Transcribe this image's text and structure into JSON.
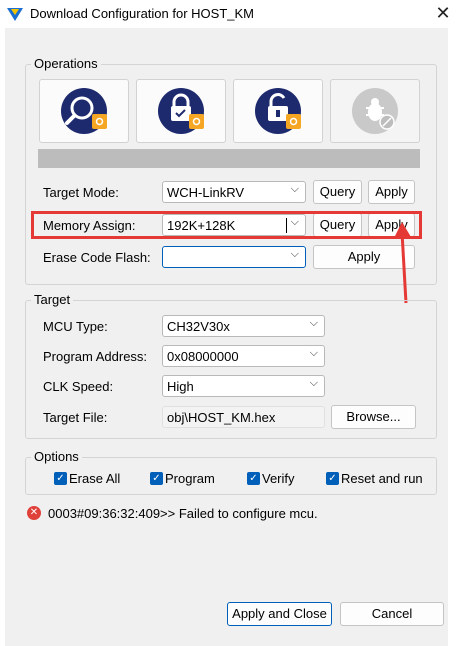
{
  "window": {
    "title": "Download Configuration for HOST_KM",
    "close_label": "✕"
  },
  "operations": {
    "legend": "Operations",
    "target_mode": {
      "label": "Target Mode:",
      "value": "WCH-LinkRV",
      "query_label": "Query",
      "apply_label": "Apply"
    },
    "memory_assign": {
      "label": "Memory Assign:",
      "value": "192K+128K",
      "query_label": "Query",
      "apply_label": "Apply"
    },
    "erase_code_flash": {
      "label": "Erase Code Flash:",
      "value": "",
      "apply_label": "Apply"
    }
  },
  "target": {
    "legend": "Target",
    "mcu_type": {
      "label": "MCU Type:",
      "value": "CH32V30x"
    },
    "program_address": {
      "label": "Program Address:",
      "value": "0x08000000"
    },
    "clk_speed": {
      "label": "CLK Speed:",
      "value": "High"
    },
    "target_file": {
      "label": "Target File:",
      "value": "obj\\HOST_KM.hex",
      "browse_label": "Browse..."
    }
  },
  "options": {
    "legend": "Options",
    "items": [
      {
        "label": "Erase All",
        "checked": true
      },
      {
        "label": "Program",
        "checked": true
      },
      {
        "label": "Verify",
        "checked": true
      },
      {
        "label": "Reset and run",
        "checked": true
      }
    ]
  },
  "log": {
    "message": "0003#09:36:32:409>> Failed to configure mcu."
  },
  "footer": {
    "apply_close_label": "Apply and Close",
    "cancel_label": "Cancel"
  },
  "colors": {
    "accent": "#005fb8",
    "annotation": "#e53935",
    "icon_bg": "#1e2a6e",
    "icon_badge": "#f5a623"
  }
}
